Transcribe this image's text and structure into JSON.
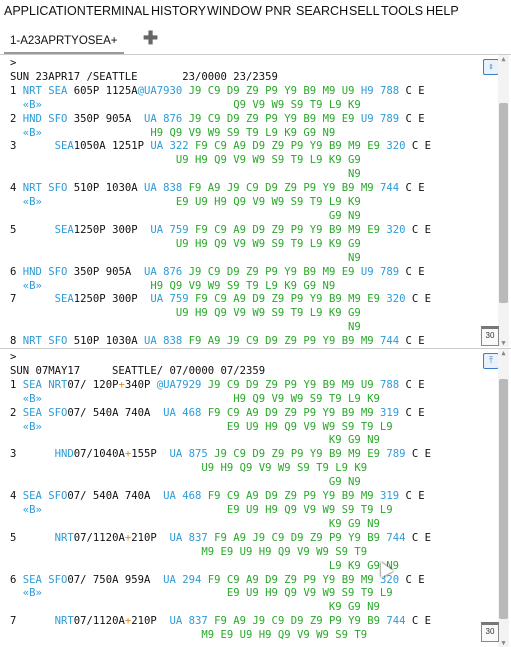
{
  "menu": [
    "APPLICATION",
    "TERMINAL",
    "HISTORY",
    "WINDOW",
    "PNR",
    "SEARCH",
    "SELL",
    "TOOLS",
    "HELP"
  ],
  "tab": {
    "label": "1-A23APRTYOSEA+",
    "add_icon": "plus-icon"
  },
  "pane1": {
    "lines": [
      [
        [
          "k",
          "> "
        ]
      ],
      [
        [
          "k",
          "SUN 23APR17 /SEATTLE       23/0000 23/2359"
        ]
      ],
      [
        [
          "k",
          "1 "
        ],
        [
          "b",
          "NRT SEA"
        ],
        [
          "k",
          " 605P 1125A"
        ],
        [
          "b",
          "@UA7930"
        ],
        [
          "g",
          " J9 C9 D9 Z9 P9 Y9 B9 M9 U9 "
        ],
        [
          "b",
          "H9 788"
        ],
        [
          "k",
          " C E"
        ]
      ],
      [
        [
          "b",
          "  «B»"
        ],
        [
          "g",
          "                              Q9 V9 W9 S9 T9 L9 K9"
        ]
      ],
      [
        [
          "k",
          "2 "
        ],
        [
          "b",
          "HND SFO"
        ],
        [
          "k",
          " 350P 905A  "
        ],
        [
          "b",
          "UA 876"
        ],
        [
          "g",
          " J9 C9 D9 Z9 P9 Y9 B9 M9 E9 "
        ],
        [
          "b",
          "U9 789"
        ],
        [
          "k",
          " C E"
        ]
      ],
      [
        [
          "b",
          "  «B»"
        ],
        [
          "g",
          "                 H9 Q9 V9 W9 S9 T9 L9 K9 G9 N9"
        ]
      ],
      [
        [
          "k",
          "3      "
        ],
        [
          "b",
          "SEA"
        ],
        [
          "k",
          "1050A 1251P "
        ],
        [
          "b",
          "UA 322"
        ],
        [
          "g",
          " F9 C9 A9 D9 Z9 P9 Y9 B9 M9 E9 "
        ],
        [
          "b",
          "320"
        ],
        [
          "k",
          " C E"
        ]
      ],
      [
        [
          "g",
          "                          U9 H9 Q9 V9 W9 S9 T9 L9 K9 G9"
        ]
      ],
      [
        [
          "g",
          "                                                     N9"
        ]
      ],
      [
        [
          "k",
          "4 "
        ],
        [
          "b",
          "NRT SFO"
        ],
        [
          "k",
          " 510P 1030A "
        ],
        [
          "b",
          "UA 838"
        ],
        [
          "g",
          " F9 A9 J9 C9 D9 Z9 P9 Y9 B9 M9 "
        ],
        [
          "b",
          "744"
        ],
        [
          "k",
          " C E"
        ]
      ],
      [
        [
          "b",
          "  «B»"
        ],
        [
          "g",
          "                     E9 U9 H9 Q9 V9 W9 S9 T9 L9 K9"
        ]
      ],
      [
        [
          "g",
          "                                                  G9 N9"
        ]
      ],
      [
        [
          "k",
          "5      "
        ],
        [
          "b",
          "SEA"
        ],
        [
          "k",
          "1250P 300P  "
        ],
        [
          "b",
          "UA 759"
        ],
        [
          "g",
          " F9 C9 A9 D9 Z9 P9 Y9 B9 M9 E9 "
        ],
        [
          "b",
          "320"
        ],
        [
          "k",
          " C E"
        ]
      ],
      [
        [
          "g",
          "                          U9 H9 Q9 V9 W9 S9 T9 L9 K9 G9"
        ]
      ],
      [
        [
          "g",
          "                                                     N9"
        ]
      ],
      [
        [
          "k",
          "6 "
        ],
        [
          "b",
          "HND SFO"
        ],
        [
          "k",
          " 350P 905A  "
        ],
        [
          "b",
          "UA 876"
        ],
        [
          "g",
          " J9 C9 D9 Z9 P9 Y9 B9 M9 E9 "
        ],
        [
          "b",
          "U9 789"
        ],
        [
          "k",
          " C E"
        ]
      ],
      [
        [
          "b",
          "  «B»"
        ],
        [
          "g",
          "                 H9 Q9 V9 W9 S9 T9 L9 K9 G9 N9"
        ]
      ],
      [
        [
          "k",
          "7      "
        ],
        [
          "b",
          "SEA"
        ],
        [
          "k",
          "1250P 300P  "
        ],
        [
          "b",
          "UA 759"
        ],
        [
          "g",
          " F9 C9 A9 D9 Z9 P9 Y9 B9 M9 E9 "
        ],
        [
          "b",
          "320"
        ],
        [
          "k",
          " C E"
        ]
      ],
      [
        [
          "g",
          "                          U9 H9 Q9 V9 W9 S9 T9 L9 K9 G9"
        ]
      ],
      [
        [
          "g",
          "                                                     N9"
        ]
      ],
      [
        [
          "k",
          "8 "
        ],
        [
          "b",
          "NRT SFO"
        ],
        [
          "k",
          " 510P 1030A "
        ],
        [
          "b",
          "UA 838"
        ],
        [
          "g",
          " F9 A9 J9 C9 D9 Z9 P9 Y9 B9 M9 "
        ],
        [
          "b",
          "744"
        ],
        [
          "k",
          " C E"
        ]
      ]
    ]
  },
  "pane2": {
    "lines": [
      [
        [
          "k",
          "> "
        ]
      ],
      [
        [
          "k",
          "SUN 07MAY17     SEATTLE/ 07/0000 07/2359"
        ]
      ],
      [
        [
          "k",
          "1 "
        ],
        [
          "b",
          "SEA NRT"
        ],
        [
          "k",
          "07/ 120P"
        ],
        [
          "o",
          "+"
        ],
        [
          "k",
          "340P "
        ],
        [
          "b",
          "@UA7929"
        ],
        [
          "g",
          " J9 C9 D9 Z9 P9 Y9 B9 M9 U9 "
        ],
        [
          "b",
          "788"
        ],
        [
          "k",
          " C E"
        ]
      ],
      [
        [
          "b",
          "  «B»"
        ],
        [
          "g",
          "                              H9 Q9 V9 W9 S9 T9 L9 K9"
        ]
      ],
      [
        [
          "k",
          "2 "
        ],
        [
          "b",
          "SEA SFO"
        ],
        [
          "k",
          "07/ 540A 740A  "
        ],
        [
          "b",
          "UA 468"
        ],
        [
          "g",
          " F9 C9 A9 D9 Z9 P9 Y9 B9 M9 "
        ],
        [
          "b",
          "319"
        ],
        [
          "k",
          " C E"
        ]
      ],
      [
        [
          "b",
          "  «B»"
        ],
        [
          "g",
          "                             E9 U9 H9 Q9 V9 W9 S9 T9 L9"
        ]
      ],
      [
        [
          "g",
          "                                                  K9 G9 N9"
        ]
      ],
      [
        [
          "k",
          "3      "
        ],
        [
          "b",
          "HND"
        ],
        [
          "k",
          "07/1040A"
        ],
        [
          "o",
          "+"
        ],
        [
          "k",
          "155P  "
        ],
        [
          "b",
          "UA 875"
        ],
        [
          "g",
          " J9 C9 D9 Z9 P9 Y9 B9 M9 E9 "
        ],
        [
          "b",
          "789"
        ],
        [
          "k",
          " C E"
        ]
      ],
      [
        [
          "g",
          "                              U9 H9 Q9 V9 W9 S9 T9 L9 K9"
        ]
      ],
      [
        [
          "g",
          "                                                  G9 N9"
        ]
      ],
      [
        [
          "k",
          "4 "
        ],
        [
          "b",
          "SEA SFO"
        ],
        [
          "k",
          "07/ 540A 740A  "
        ],
        [
          "b",
          "UA 468"
        ],
        [
          "g",
          " F9 C9 A9 D9 Z9 P9 Y9 B9 M9 "
        ],
        [
          "b",
          "319"
        ],
        [
          "k",
          " C E"
        ]
      ],
      [
        [
          "b",
          "  «B»"
        ],
        [
          "g",
          "                             E9 U9 H9 Q9 V9 W9 S9 T9 L9"
        ]
      ],
      [
        [
          "g",
          "                                                  K9 G9 N9"
        ]
      ],
      [
        [
          "k",
          "5      "
        ],
        [
          "b",
          "NRT"
        ],
        [
          "k",
          "07/1120A"
        ],
        [
          "o",
          "+"
        ],
        [
          "k",
          "210P  "
        ],
        [
          "b",
          "UA 837"
        ],
        [
          "g",
          " F9 A9 J9 C9 D9 Z9 P9 Y9 B9 "
        ],
        [
          "b",
          "744"
        ],
        [
          "k",
          " C E"
        ]
      ],
      [
        [
          "g",
          "                              M9 E9 U9 H9 Q9 V9 W9 S9 T9"
        ]
      ],
      [
        [
          "g",
          "                                                  L9 K9 G9 N9"
        ]
      ],
      [
        [
          "k",
          "6 "
        ],
        [
          "b",
          "SEA SFO"
        ],
        [
          "k",
          "07/ 750A 959A  "
        ],
        [
          "b",
          "UA 294"
        ],
        [
          "g",
          " F9 C9 A9 D9 Z9 P9 Y9 B9 M9 "
        ],
        [
          "b",
          "320"
        ],
        [
          "k",
          " C E"
        ]
      ],
      [
        [
          "b",
          "  «B»"
        ],
        [
          "g",
          "                             E9 U9 H9 Q9 V9 W9 S9 T9 L9"
        ]
      ],
      [
        [
          "g",
          "                                                  K9 G9 N9"
        ]
      ],
      [
        [
          "k",
          "7      "
        ],
        [
          "b",
          "NRT"
        ],
        [
          "k",
          "07/1120A"
        ],
        [
          "o",
          "+"
        ],
        [
          "k",
          "210P  "
        ],
        [
          "b",
          "UA 837"
        ],
        [
          "g",
          " F9 A9 J9 C9 D9 Z9 P9 Y9 B9 "
        ],
        [
          "b",
          "744"
        ],
        [
          "k",
          " C E"
        ]
      ],
      [
        [
          "g",
          "                              M9 E9 U9 H9 Q9 V9 W9 S9 T9"
        ]
      ]
    ]
  },
  "calendar_label": "30",
  "colors": {
    "availability": "#29a829",
    "city_flight": "#2e9bd6",
    "text": "#111111",
    "plus_day": "#e08a1a"
  }
}
